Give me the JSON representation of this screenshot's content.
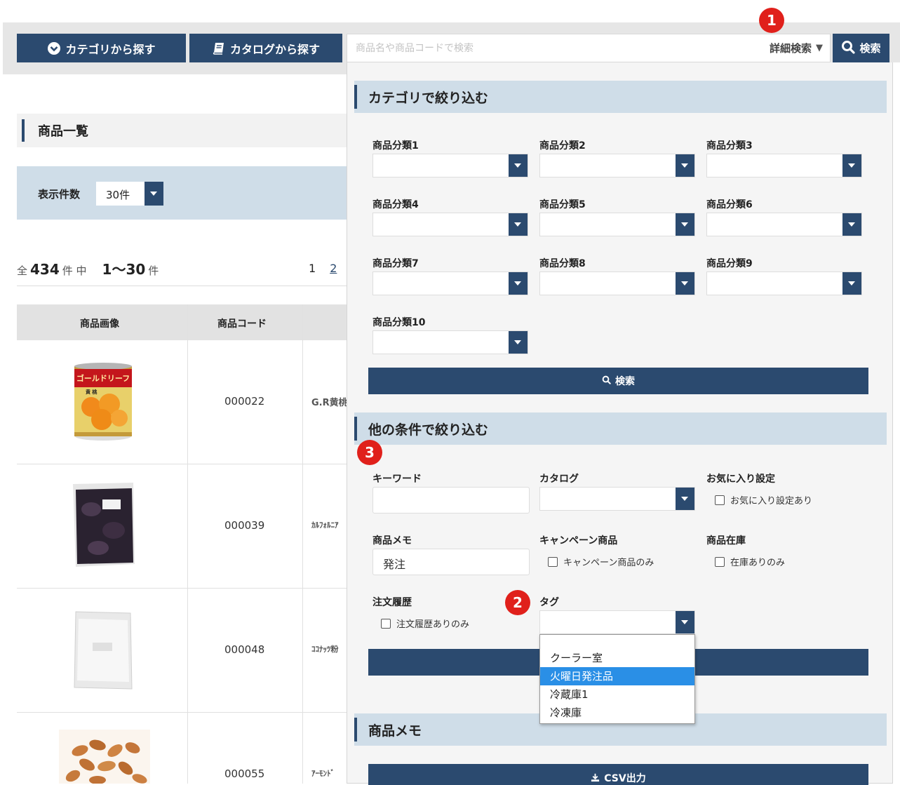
{
  "nav": {
    "category_btn": "カテゴリから探す",
    "catalog_btn": "カタログから探す",
    "search_placeholder": "商品名や商品コードで検索",
    "advanced_label": "詳細検索",
    "advanced_arrow": "▼",
    "search_btn": "検索"
  },
  "page": {
    "title": "商品一覧",
    "per_page_label": "表示件数",
    "per_page_value": "30件",
    "count": {
      "prefix": "全",
      "total": "434",
      "suffix_total": "件 中",
      "range": "1〜30",
      "suffix_range": "件"
    },
    "pager": [
      "1",
      "2"
    ]
  },
  "table": {
    "headers": [
      "商品画像",
      "商品コード"
    ],
    "rows": [
      {
        "code": "000022",
        "name": "G.R黄桃",
        "can_label": "ゴールドリーフ",
        "can_sub": "黄 桃"
      },
      {
        "code": "000039",
        "name": "ｶﾙﾌｫﾙﾆｱ"
      },
      {
        "code": "000048",
        "name": "ｺｺﾅｯﾂ粉"
      },
      {
        "code": "000055",
        "name": "ｱｰﾓﾝﾄﾞ"
      }
    ]
  },
  "panel": {
    "category_title": "カテゴリで絞り込む",
    "categories": [
      "商品分類1",
      "商品分類2",
      "商品分類3",
      "商品分類4",
      "商品分類5",
      "商品分類6",
      "商品分類7",
      "商品分類8",
      "商品分類9",
      "商品分類10"
    ],
    "search_btn": "検索",
    "other_title": "他の条件で絞り込む",
    "keyword_label": "キーワード",
    "catalog_label": "カタログ",
    "favorite_label": "お気に入り設定",
    "favorite_check": "お気に入り設定あり",
    "memo_label": "商品メモ",
    "memo_value": "発注",
    "campaign_label": "キャンペーン商品",
    "campaign_check": "キャンペーン商品のみ",
    "stock_label": "商品在庫",
    "stock_check": "在庫ありのみ",
    "history_label": "注文履歴",
    "history_check": "注文履歴ありのみ",
    "tag_label": "タグ",
    "tag_options": [
      "クーラー室",
      "火曜日発注品",
      "冷蔵庫1",
      "冷凍庫"
    ],
    "tag_highlighted": 1,
    "memo_title": "商品メモ",
    "csv_btn": "CSV出力"
  },
  "badges": [
    "1",
    "2",
    "3"
  ],
  "colors": {
    "navy": "#2b4a6f",
    "panel_title_bg": "#cfdde8",
    "highlight": "#2a8fe6",
    "badge": "#e0201b"
  }
}
